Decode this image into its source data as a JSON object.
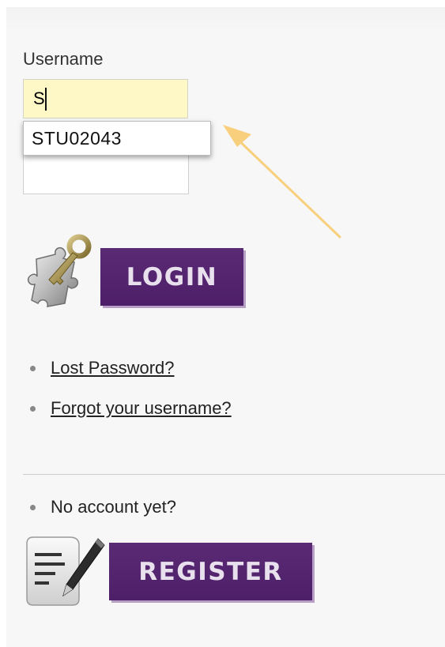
{
  "login_form": {
    "username_label": "Username",
    "username_value": "S",
    "password_value": "",
    "autocomplete_suggestion": "STU02043",
    "login_button_label": "LOGIN"
  },
  "links": {
    "lost_password": "Lost Password?",
    "forgot_username": "Forgot your username?"
  },
  "register_section": {
    "no_account_text": "No account yet?",
    "register_button_label": "REGISTER"
  },
  "icons": {
    "login_icon": "puzzle-key-icon",
    "register_icon": "document-pen-icon",
    "annotation": "arrow-annotation"
  },
  "colors": {
    "button_bg": "#55246f",
    "button_shadow": "#b79fc6",
    "input_autofill_bg": "#fdf8c6",
    "arrow": "#f8cf7c"
  }
}
